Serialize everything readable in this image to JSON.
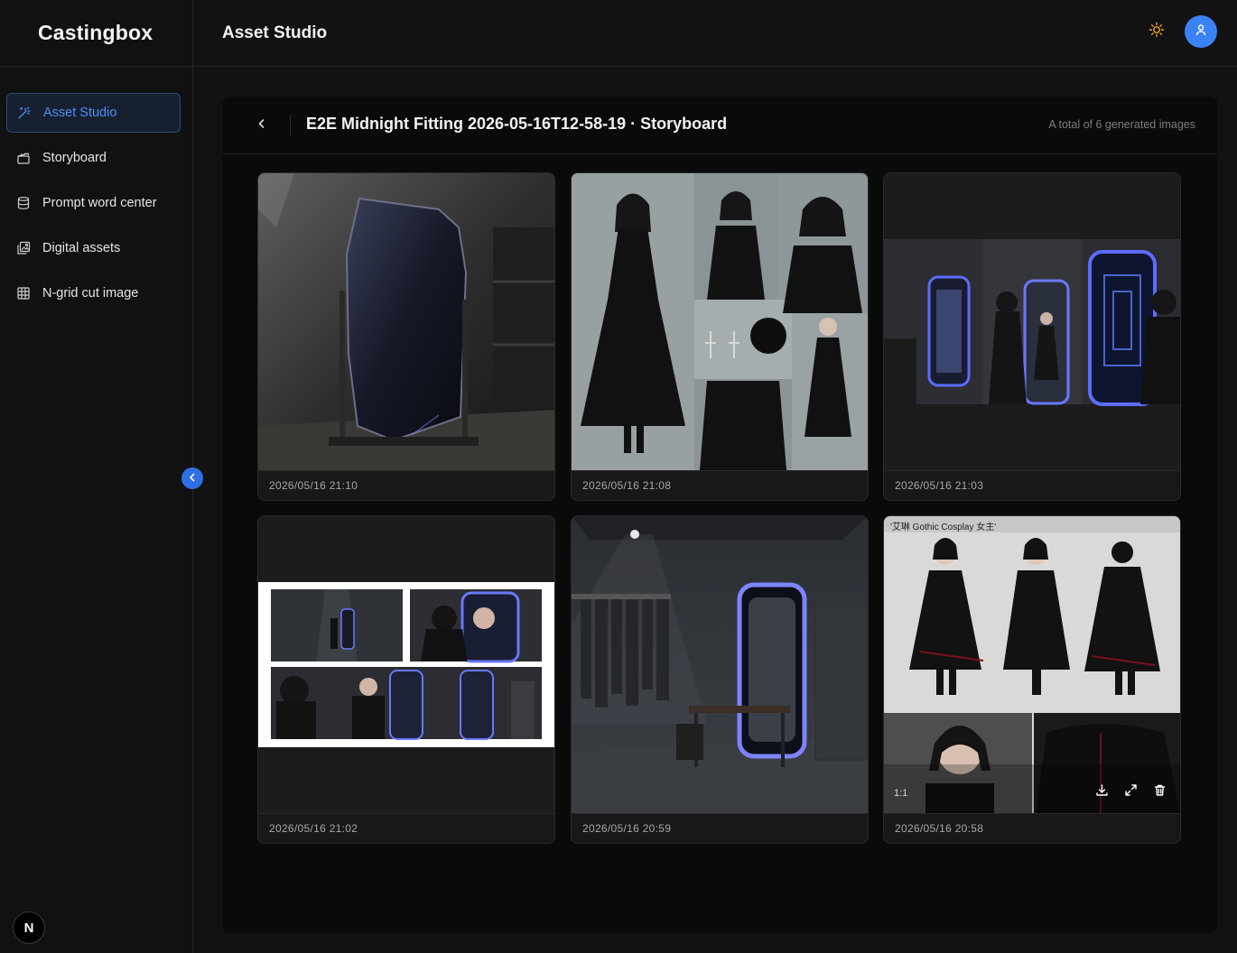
{
  "app": {
    "brand": "Castingbox",
    "page_title": "Asset Studio",
    "nav_badge": "N"
  },
  "sidebar": {
    "items": [
      {
        "label": "Asset Studio",
        "icon": "magic-wand-icon",
        "active": true
      },
      {
        "label": "Storyboard",
        "icon": "clapperboard-icon",
        "active": false
      },
      {
        "label": "Prompt word center",
        "icon": "database-icon",
        "active": false
      },
      {
        "label": "Digital assets",
        "icon": "images-icon",
        "active": false
      },
      {
        "label": "N-grid cut image",
        "icon": "grid-icon",
        "active": false
      }
    ]
  },
  "header": {
    "theme_icon": "sun-icon",
    "avatar_icon": "user-icon"
  },
  "panel": {
    "title": "E2E Midnight Fitting 2026-05-16T12-58-19 · Storyboard",
    "count_text": "A total of 6 generated images"
  },
  "images": [
    {
      "timestamp": "2026/05/16 21:10",
      "subject": "obsidian-mirror"
    },
    {
      "timestamp": "2026/05/16 21:08",
      "subject": "gothic-character-sheet"
    },
    {
      "timestamp": "2026/05/16 21:03",
      "subject": "mirror-storyboard-strip"
    },
    {
      "timestamp": "2026/05/16 21:02",
      "subject": "storyboard-grid"
    },
    {
      "timestamp": "2026/05/16 20:59",
      "subject": "dark-fitting-room"
    },
    {
      "timestamp": "2026/05/16 20:58",
      "subject": "cosplay-turnaround",
      "label": "'艾琳 Gothic Cosplay 女主'",
      "ratio": "1:1",
      "hovered": true
    }
  ],
  "colors": {
    "accent": "#3b82f6",
    "sun": "#f5a623",
    "background": "#121212",
    "panel": "#0a0a0a"
  }
}
